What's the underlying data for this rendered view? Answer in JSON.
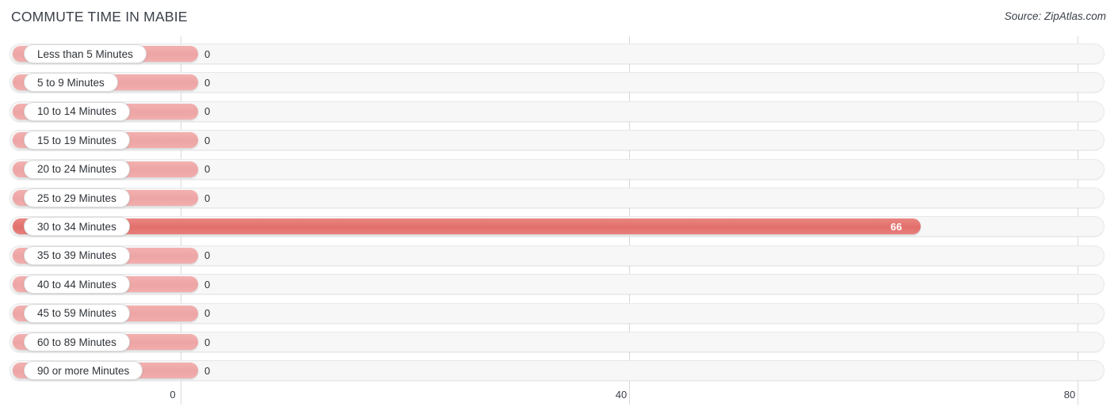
{
  "header": {
    "title": "COMMUTE TIME IN MABIE",
    "source": "Source: ZipAtlas.com"
  },
  "colors": {
    "bar_zero": "#eda4a4",
    "bar_highlight": "#e26f6c",
    "track": "#f7f7f7",
    "grid": "#d8d8d8",
    "text": "#3b4049"
  },
  "chart_data": {
    "type": "bar",
    "orientation": "horizontal",
    "title": "COMMUTE TIME IN MABIE",
    "xlabel": "",
    "ylabel": "",
    "xlim": [
      0,
      80
    ],
    "ticks": [
      "0",
      "40",
      "80"
    ],
    "tick_values": [
      0,
      40,
      80
    ],
    "grid": true,
    "legend": "none",
    "categories": [
      "Less than 5 Minutes",
      "5 to 9 Minutes",
      "10 to 14 Minutes",
      "15 to 19 Minutes",
      "20 to 24 Minutes",
      "25 to 29 Minutes",
      "30 to 34 Minutes",
      "35 to 39 Minutes",
      "40 to 44 Minutes",
      "45 to 59 Minutes",
      "60 to 89 Minutes",
      "90 or more Minutes"
    ],
    "values": [
      0,
      0,
      0,
      0,
      0,
      0,
      66,
      0,
      0,
      0,
      0,
      0
    ],
    "value_labels": [
      "0",
      "0",
      "0",
      "0",
      "0",
      "0",
      "66",
      "0",
      "0",
      "0",
      "0",
      "0"
    ]
  },
  "rows": [
    {
      "label": "Less than 5 Minutes",
      "value_label": "0",
      "value": 0,
      "highlight": false
    },
    {
      "label": "5 to 9 Minutes",
      "value_label": "0",
      "value": 0,
      "highlight": false
    },
    {
      "label": "10 to 14 Minutes",
      "value_label": "0",
      "value": 0,
      "highlight": false
    },
    {
      "label": "15 to 19 Minutes",
      "value_label": "0",
      "value": 0,
      "highlight": false
    },
    {
      "label": "20 to 24 Minutes",
      "value_label": "0",
      "value": 0,
      "highlight": false
    },
    {
      "label": "25 to 29 Minutes",
      "value_label": "0",
      "value": 0,
      "highlight": false
    },
    {
      "label": "30 to 34 Minutes",
      "value_label": "66",
      "value": 66,
      "highlight": true
    },
    {
      "label": "35 to 39 Minutes",
      "value_label": "0",
      "value": 0,
      "highlight": false
    },
    {
      "label": "40 to 44 Minutes",
      "value_label": "0",
      "value": 0,
      "highlight": false
    },
    {
      "label": "45 to 59 Minutes",
      "value_label": "0",
      "value": 0,
      "highlight": false
    },
    {
      "label": "60 to 89 Minutes",
      "value_label": "0",
      "value": 0,
      "highlight": false
    },
    {
      "label": "90 or more Minutes",
      "value_label": "0",
      "value": 0,
      "highlight": false
    }
  ],
  "axis": {
    "ticks": [
      "0",
      "40",
      "80"
    ]
  }
}
